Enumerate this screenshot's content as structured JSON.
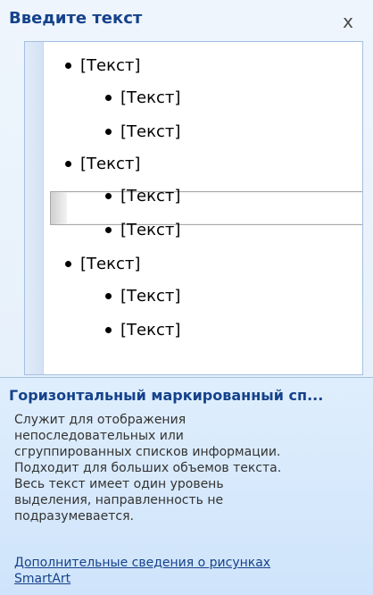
{
  "pane": {
    "title": "Введите текст",
    "close_label": "x"
  },
  "outline": {
    "items": [
      {
        "level": 1,
        "text": "[Текст]"
      },
      {
        "level": 2,
        "text": "[Текст]"
      },
      {
        "level": 2,
        "text": "[Текст]"
      },
      {
        "level": 1,
        "text": "[Текст]",
        "selected": true
      },
      {
        "level": 2,
        "text": "[Текст]"
      },
      {
        "level": 2,
        "text": "[Текст]"
      },
      {
        "level": 1,
        "text": "[Текст]"
      },
      {
        "level": 2,
        "text": "[Текст]"
      },
      {
        "level": 2,
        "text": "[Текст]"
      }
    ]
  },
  "description": {
    "title": "Горизонтальный маркированный сп...",
    "body_lines": [
      "Служит для отображения",
      "непоследовательных или",
      "сгруппированных списков информации.",
      "Подходит для больших объемов текста.",
      "Весь текст имеет один уровень",
      "выделения, направленность не",
      "подразумевается."
    ],
    "link_lines": [
      "Дополнительные сведения о рисунках",
      "SmartArt"
    ]
  },
  "colors": {
    "title_blue": "#15428b",
    "pane_background": "#e9f2fb",
    "border_blue": "#a3bfe3"
  }
}
